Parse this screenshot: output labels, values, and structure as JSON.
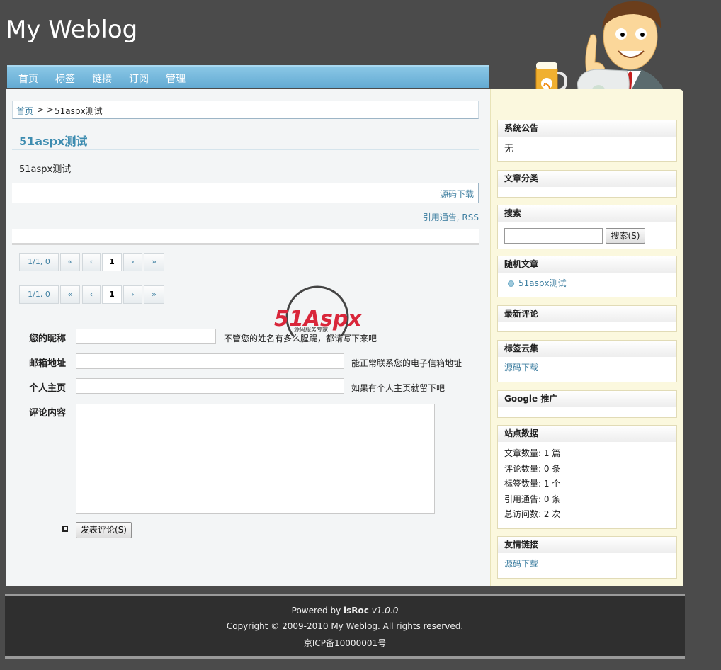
{
  "site": {
    "title": "My Weblog"
  },
  "nav": [
    "首页",
    "标签",
    "链接",
    "订阅",
    "管理"
  ],
  "breadcrumb": {
    "home": "首页",
    "sep": "> >",
    "current": "51aspx测试"
  },
  "post": {
    "title": "51aspx测试",
    "body": "51aspx测试",
    "tag_link": "源码下载",
    "trackback_label": "引用通告",
    "rss_label": "RSS"
  },
  "pager": {
    "summary": "1/1, 0",
    "first": "«",
    "prev": "‹",
    "page": "1",
    "next": "›",
    "last": "»"
  },
  "form": {
    "name_label": "您的昵称",
    "name_hint": "不管您的姓名有多么腥踶，都请写下来吧",
    "email_label": "邮箱地址",
    "email_hint": "能正常联系您的电子信箱地址",
    "home_label": "个人主页",
    "home_hint": "如果有个人主页就留下吧",
    "content_label": "评论内容",
    "submit_label": "发表评论(S)"
  },
  "watermark": {
    "brand": "51Aspx",
    "sub": "源码服务专家"
  },
  "sidebar": {
    "announce_title": "系统公告",
    "announce_body": "无",
    "category_title": "文章分类",
    "search_title": "搜索",
    "search_button": "搜索(S)",
    "random_title": "随机文章",
    "random_item": "51aspx测试",
    "recent_comments_title": "最新评论",
    "tag_cloud_title": "标签云集",
    "tag_cloud_item": "源码下载",
    "google_title": "Google 推广",
    "stats_title": "站点数据",
    "stats": [
      "文章数量: 1 篇",
      "评论数量: 0 条",
      "标签数量: 1 个",
      "引用通告: 0 条",
      "总访问数: 2 次"
    ],
    "links_title": "友情链接",
    "links_item": "源码下载"
  },
  "footer": {
    "powered_prefix": "Powered by ",
    "powered_brand": "isRoc",
    "powered_version": " v1.0.0",
    "copyright": "Copyright © 2009-2010 My Weblog. All rights reserved.",
    "icp": "京ICP备10000001号"
  },
  "colors": {
    "background": "#4b4b4b",
    "nav": "#6fb4da",
    "link": "#3d7ea0",
    "sidebar": "#fbf8de"
  }
}
